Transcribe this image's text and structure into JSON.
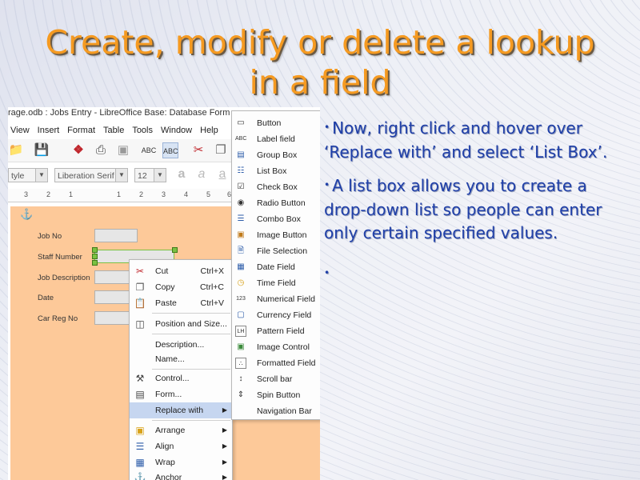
{
  "slide": {
    "title": "Create, modify or delete a lookup in a field",
    "bullets": [
      "Now, right click and hover over ‘Replace with’ and select ‘List Box’.",
      "A list box allows you to create a drop-down list so people can enter only certain specified values.",
      ""
    ],
    "bullet_mark": "•"
  },
  "window": {
    "title": "rage.odb : Jobs Entry - LibreOffice Base: Database Form"
  },
  "menubar": [
    "View",
    "Insert",
    "Format",
    "Table",
    "Tools",
    "Window",
    "Help"
  ],
  "toolbar": {
    "style_combo": "tyle",
    "font_combo": "Liberation Serif",
    "size_combo": "12"
  },
  "ruler_marks": [
    "3",
    "2",
    "1",
    "1",
    "2",
    "3",
    "4",
    "5",
    "6"
  ],
  "form": {
    "fields": [
      "Job No",
      "Staff Number",
      "Job Description",
      "Date",
      "Car Reg No"
    ]
  },
  "context_menu": [
    {
      "label": "Cut",
      "shortcut": "Ctrl+X",
      "icon": "scissors-icon"
    },
    {
      "label": "Copy",
      "shortcut": "Ctrl+C",
      "icon": "copy-icon"
    },
    {
      "label": "Paste",
      "shortcut": "Ctrl+V",
      "icon": "paste-icon"
    },
    {
      "label": "Position and Size...",
      "shortcut": "",
      "icon": "position-size-icon"
    },
    {
      "label": "Description...",
      "shortcut": "",
      "icon": ""
    },
    {
      "label": "Name...",
      "shortcut": "",
      "icon": ""
    },
    {
      "label": "Control...",
      "shortcut": "",
      "icon": "control-properties-icon"
    },
    {
      "label": "Form...",
      "shortcut": "",
      "icon": "form-properties-icon"
    },
    {
      "label": "Replace with",
      "shortcut": "",
      "icon": "",
      "submenu": true,
      "highlighted": true
    },
    {
      "label": "Arrange",
      "shortcut": "",
      "icon": "arrange-icon",
      "submenu": true
    },
    {
      "label": "Align",
      "shortcut": "",
      "icon": "align-icon",
      "submenu": true
    },
    {
      "label": "Wrap",
      "shortcut": "",
      "icon": "wrap-icon",
      "submenu": true
    },
    {
      "label": "Anchor",
      "shortcut": "",
      "icon": "anchor-icon",
      "submenu": true
    }
  ],
  "replace_submenu": [
    {
      "label": "Button",
      "icon": "button-icon"
    },
    {
      "label": "Label field",
      "icon": "label-field-icon"
    },
    {
      "label": "Group Box",
      "icon": "group-box-icon"
    },
    {
      "label": "List Box",
      "icon": "list-box-icon"
    },
    {
      "label": "Check Box",
      "icon": "check-box-icon"
    },
    {
      "label": "Radio Button",
      "icon": "radio-button-icon"
    },
    {
      "label": "Combo Box",
      "icon": "combo-box-icon"
    },
    {
      "label": "Image Button",
      "icon": "image-button-icon"
    },
    {
      "label": "File Selection",
      "icon": "file-selection-icon"
    },
    {
      "label": "Date Field",
      "icon": "date-field-icon"
    },
    {
      "label": "Time Field",
      "icon": "time-field-icon"
    },
    {
      "label": "Numerical Field",
      "icon": "numerical-field-icon"
    },
    {
      "label": "Currency Field",
      "icon": "currency-field-icon"
    },
    {
      "label": "Pattern Field",
      "icon": "pattern-field-icon"
    },
    {
      "label": "Image Control",
      "icon": "image-control-icon"
    },
    {
      "label": "Formatted Field",
      "icon": "formatted-field-icon"
    },
    {
      "label": "Scroll bar",
      "icon": "scroll-bar-icon"
    },
    {
      "label": "Spin Button",
      "icon": "spin-button-icon"
    },
    {
      "label": "Navigation Bar",
      "icon": "navigation-bar-icon"
    }
  ],
  "colors": {
    "title": "#f59a21",
    "bullet_text": "#1f3fa8",
    "form_background": "#fdc999",
    "menu_highlight": "#c6d6f0"
  }
}
